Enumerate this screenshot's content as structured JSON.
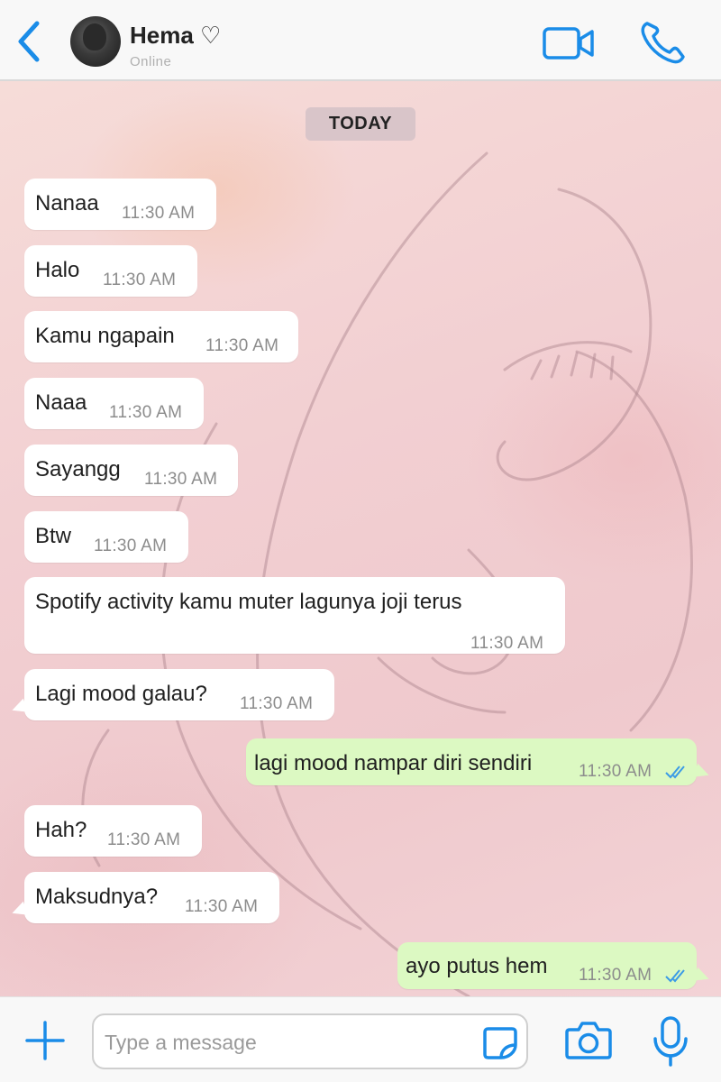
{
  "header": {
    "contact_name": "Hema ♡",
    "status": "Online"
  },
  "chat": {
    "date_label": "TODAY",
    "messages": [
      {
        "text": "Nanaa",
        "time": "11:30 AM",
        "direction": "incoming"
      },
      {
        "text": "Halo",
        "time": "11:30 AM",
        "direction": "incoming"
      },
      {
        "text": "Kamu ngapain",
        "time": "11:30 AM",
        "direction": "incoming"
      },
      {
        "text": "Naaa",
        "time": "11:30 AM",
        "direction": "incoming"
      },
      {
        "text": "Sayangg",
        "time": "11:30 AM",
        "direction": "incoming"
      },
      {
        "text": "Btw",
        "time": "11:30 AM",
        "direction": "incoming"
      },
      {
        "text": "Spotify activity kamu muter lagunya joji terus",
        "time": "11:30 AM",
        "direction": "incoming"
      },
      {
        "text": "Lagi mood galau?",
        "time": "11:30 AM",
        "direction": "incoming"
      },
      {
        "text": "lagi mood nampar diri sendiri",
        "time": "11:30 AM",
        "direction": "outgoing",
        "status": "read"
      },
      {
        "text": "Hah?",
        "time": "11:30 AM",
        "direction": "incoming"
      },
      {
        "text": "Maksudnya?",
        "time": "11:30 AM",
        "direction": "incoming"
      },
      {
        "text": "ayo putus hem",
        "time": "11:30 AM",
        "direction": "outgoing",
        "status": "read"
      }
    ]
  },
  "composer": {
    "placeholder": "Type a message"
  },
  "icons": {
    "back": "chevron-left-icon",
    "video": "video-camera-icon",
    "call": "phone-icon",
    "attach": "plus-icon",
    "sticker": "sticker-icon",
    "camera": "camera-icon",
    "mic": "microphone-icon",
    "read_receipt": "double-check-icon"
  },
  "colors": {
    "accent": "#1a8ce8",
    "incoming_bubble": "#ffffff",
    "outgoing_bubble": "#dcf9c2",
    "read_tick": "#3b9be6"
  }
}
